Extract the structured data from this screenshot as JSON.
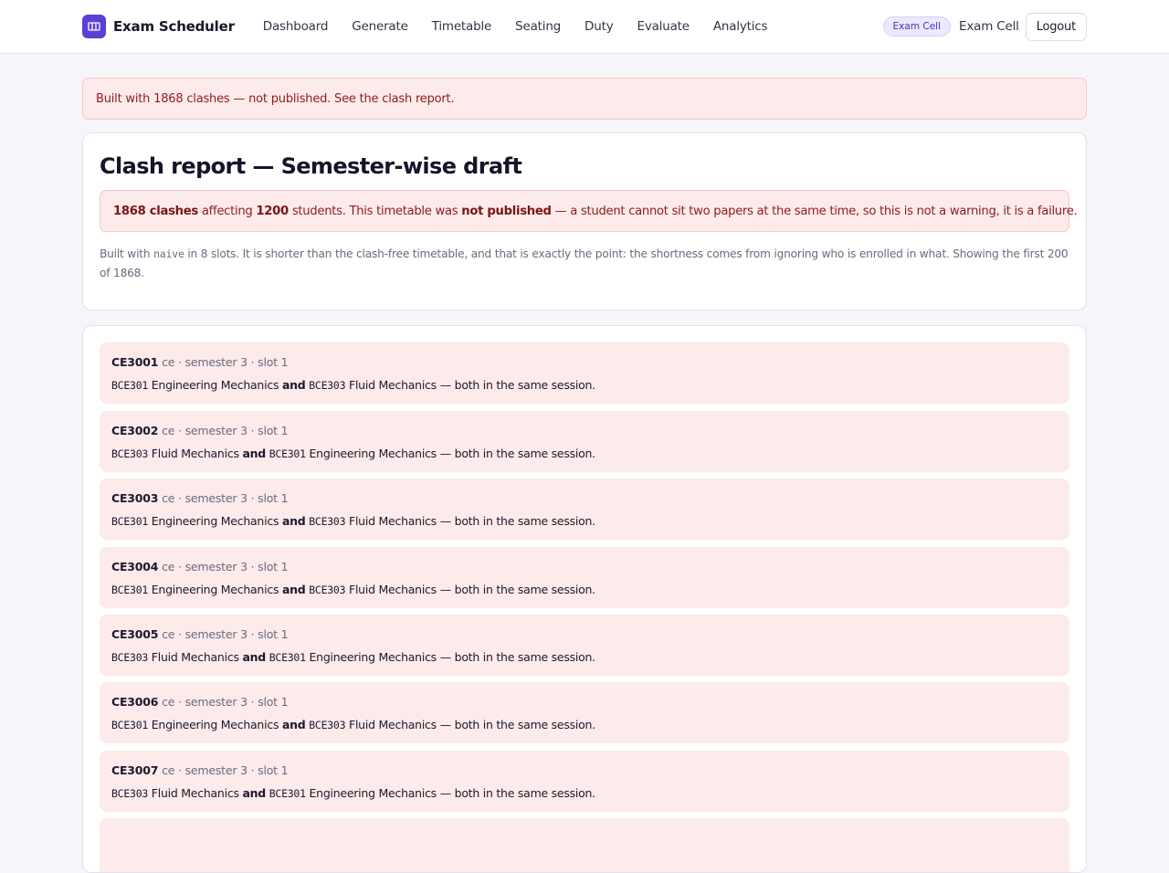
{
  "app": {
    "name": "Exam Scheduler",
    "logo_icon": "calendar-grid-icon",
    "accent_color": "#5b3fd6"
  },
  "nav": [
    "Dashboard",
    "Generate",
    "Timetable",
    "Seating",
    "Duty",
    "Evaluate",
    "Analytics"
  ],
  "user": {
    "role_badge": "Exam Cell",
    "name": "Exam Cell",
    "logout_label": "Logout"
  },
  "banner": {
    "text": "Built with 1868 clashes — not published. See the clash report."
  },
  "report": {
    "title": "Clash report — Semester-wise draft",
    "clash_count": "1868 clashes",
    "affecting": "affecting",
    "students_count": "1200",
    "students_text": "students. This timetable was",
    "not_published": "not published",
    "failure_text": "— a student cannot sit two papers at the same time, so this is not a warning, it is a failure.",
    "note_prefix": "Built with",
    "algorithm": "naive",
    "note_suffix": "in 8 slots. It is shorter than the clash-free timetable, and that is exactly the point: the shortness comes from ignoring who is enrolled in what. Showing the first 200 of 1868."
  },
  "clash_and": "and",
  "clash_suffix": "— both in the same session.",
  "clashes": [
    {
      "student": "CE3001",
      "meta": "ce · semester 3 · slot 1",
      "code_a": "BCE301",
      "name_a": "Engineering Mechanics",
      "code_b": "BCE303",
      "name_b": "Fluid Mechanics"
    },
    {
      "student": "CE3002",
      "meta": "ce · semester 3 · slot 1",
      "code_a": "BCE303",
      "name_a": "Fluid Mechanics",
      "code_b": "BCE301",
      "name_b": "Engineering Mechanics"
    },
    {
      "student": "CE3003",
      "meta": "ce · semester 3 · slot 1",
      "code_a": "BCE301",
      "name_a": "Engineering Mechanics",
      "code_b": "BCE303",
      "name_b": "Fluid Mechanics"
    },
    {
      "student": "CE3004",
      "meta": "ce · semester 3 · slot 1",
      "code_a": "BCE301",
      "name_a": "Engineering Mechanics",
      "code_b": "BCE303",
      "name_b": "Fluid Mechanics"
    },
    {
      "student": "CE3005",
      "meta": "ce · semester 3 · slot 1",
      "code_a": "BCE303",
      "name_a": "Fluid Mechanics",
      "code_b": "BCE301",
      "name_b": "Engineering Mechanics"
    },
    {
      "student": "CE3006",
      "meta": "ce · semester 3 · slot 1",
      "code_a": "BCE301",
      "name_a": "Engineering Mechanics",
      "code_b": "BCE303",
      "name_b": "Fluid Mechanics"
    },
    {
      "student": "CE3007",
      "meta": "ce · semester 3 · slot 1",
      "code_a": "BCE303",
      "name_a": "Fluid Mechanics",
      "code_b": "BCE301",
      "name_b": "Engineering Mechanics"
    }
  ]
}
